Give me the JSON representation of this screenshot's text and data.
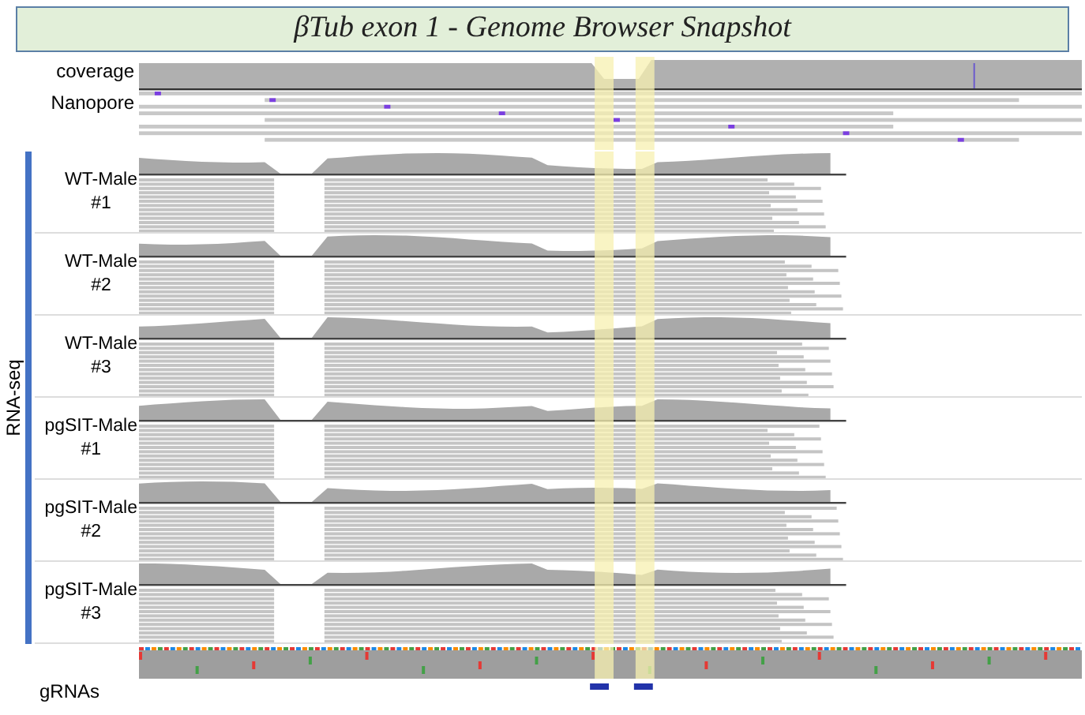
{
  "title": "βTub exon 1 - Genome Browser Snapshot",
  "top_tracks": [
    {
      "label": "coverage",
      "kind": "coverage"
    },
    {
      "label": "Nanopore",
      "kind": "reads"
    }
  ],
  "group_label": "RNA-seq",
  "samples": [
    {
      "name": "WT-Male",
      "replicate": "#1"
    },
    {
      "name": "WT-Male",
      "replicate": "#2"
    },
    {
      "name": "WT-Male",
      "replicate": "#3"
    },
    {
      "name": "pgSIT-Male",
      "replicate": "#1"
    },
    {
      "name": "pgSIT-Male",
      "replicate": "#2"
    },
    {
      "name": "pgSIT-Male",
      "replicate": "#3"
    }
  ],
  "guide_track": {
    "label": "gRNAs"
  }
}
